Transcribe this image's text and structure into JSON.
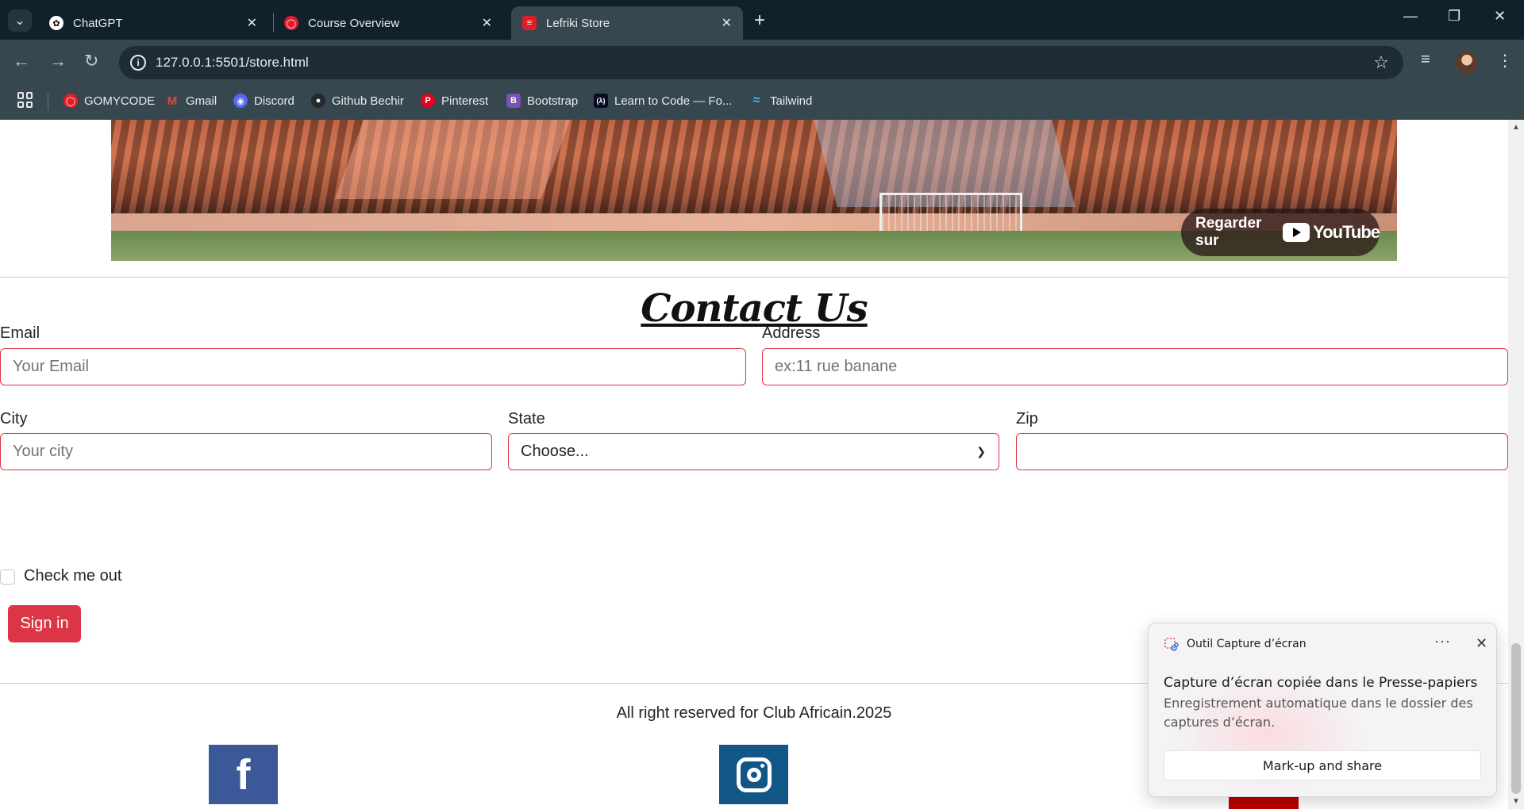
{
  "browser": {
    "tabs": [
      {
        "title": "ChatGPT",
        "icon": "chatgpt-icon"
      },
      {
        "title": "Course Overview",
        "icon": "gomycode-icon"
      },
      {
        "title": "Lefriki Store",
        "icon": "club-africain-icon"
      }
    ],
    "url": "127.0.0.1:5501/store.html",
    "bookmarks": [
      "GOMYCODE",
      "Gmail",
      "Discord",
      "Github Bechir",
      "Pinterest",
      "Bootstrap",
      "Learn to Code — Fo...",
      "Tailwind"
    ]
  },
  "video": {
    "watch_on": "Regarder sur",
    "platform": "YouTube"
  },
  "contact": {
    "title": "Contact Us",
    "email_label": "Email",
    "email_placeholder": "Your Email",
    "address_label": "Address",
    "address_placeholder": "ex:11 rue banane",
    "city_label": "City",
    "city_placeholder": "Your city",
    "state_label": "State",
    "state_value": "Choose...",
    "zip_label": "Zip",
    "zip_value": "",
    "check_label": "Check me out",
    "submit_label": "Sign in"
  },
  "footer": {
    "copyright": "All right reserved for Club Africain.2025",
    "social": [
      "facebook-icon",
      "instagram-icon",
      "youtube-icon"
    ]
  },
  "toast": {
    "app_name": "Outil Capture d’écran",
    "title": "Capture d’écran copiée dans le Presse-papiers",
    "body": "Enregistrement automatique dans le dossier des captures d’écran.",
    "action_label": "Mark-up and share"
  },
  "colors": {
    "accent": "#dc3545",
    "facebook": "#3b5998",
    "instagram": "#125688",
    "tabbar": "#10212b",
    "toolbar": "#36474f"
  }
}
